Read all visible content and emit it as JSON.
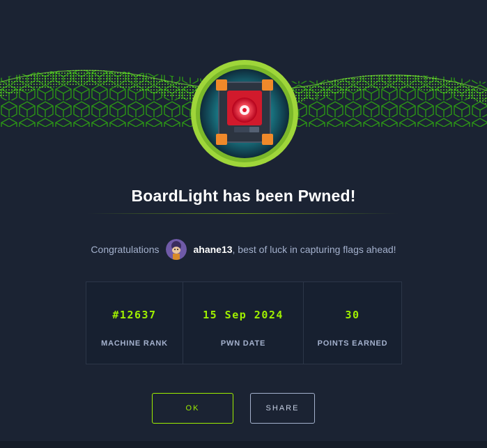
{
  "machine": {
    "title": "BoardLight has been Pwned!"
  },
  "congrats": {
    "prefix": "Congratulations",
    "username": "ahane13",
    "suffix": ", best of luck in capturing flags ahead!"
  },
  "stats": [
    {
      "value": "#12637",
      "label": "MACHINE RANK"
    },
    {
      "value": "15 Sep 2024",
      "label": "PWN DATE"
    },
    {
      "value": "30",
      "label": "POINTS EARNED"
    }
  ],
  "buttons": {
    "ok": "OK",
    "share": "SHARE"
  },
  "colors": {
    "accent": "#9fef00",
    "background": "#1b2333",
    "text_muted": "#a4b1cd",
    "badge_core": "#ff2a3c"
  },
  "icons": {
    "badge": "machine-board-icon",
    "avatar": "user-avatar"
  }
}
